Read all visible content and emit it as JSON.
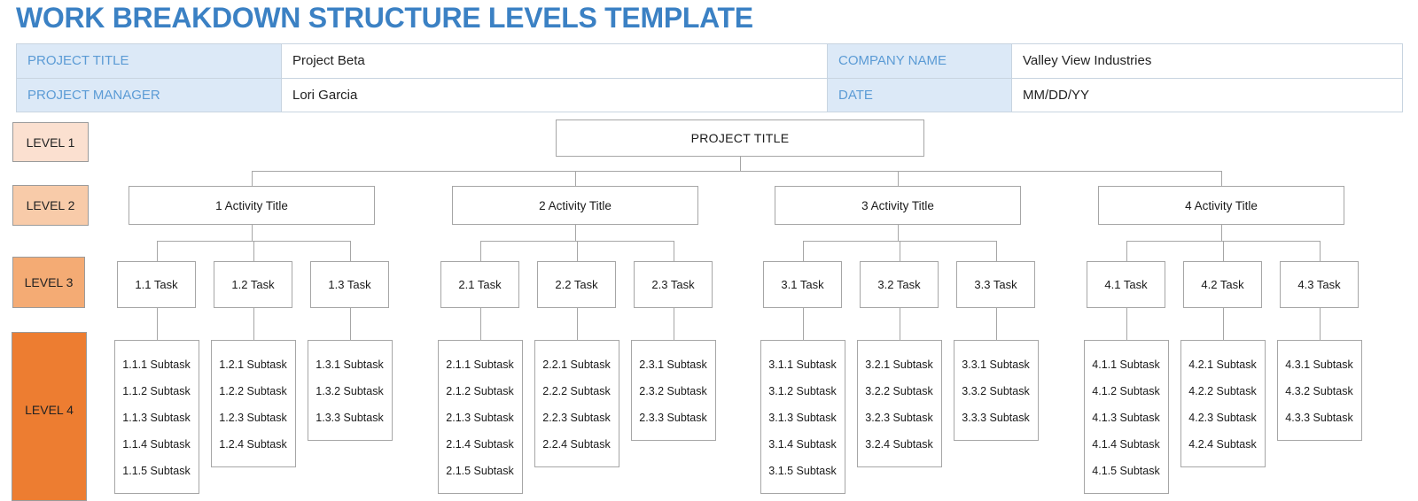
{
  "document": {
    "title": "WORK BREAKDOWN STRUCTURE LEVELS TEMPLATE",
    "title_color": "#3b81c4"
  },
  "info": {
    "project_title_label": "PROJECT TITLE",
    "project_title_value": "Project Beta",
    "company_name_label": "COMPANY NAME",
    "company_name_value": "Valley View Industries",
    "project_manager_label": "PROJECT MANAGER",
    "project_manager_value": "Lori Garcia",
    "date_label": "DATE",
    "date_value": "MM/DD/YY",
    "label_bg": "#dce9f7",
    "label_color": "#5b9bd5"
  },
  "levels": [
    {
      "label": "LEVEL 1",
      "color": "#fbe0d0"
    },
    {
      "label": "LEVEL 2",
      "color": "#f8cba9"
    },
    {
      "label": "LEVEL 3",
      "color": "#f4ab74"
    },
    {
      "label": "LEVEL 4",
      "color": "#ed7d31"
    }
  ],
  "tree": {
    "root": "PROJECT TITLE",
    "branches": [
      {
        "activity": "1 Activity Title",
        "tasks": [
          {
            "name": "1.1 Task",
            "subtasks": [
              "1.1.1 Subtask",
              "1.1.2 Subtask",
              "1.1.3 Subtask",
              "1.1.4 Subtask",
              "1.1.5 Subtask"
            ]
          },
          {
            "name": "1.2 Task",
            "subtasks": [
              "1.2.1 Subtask",
              "1.2.2 Subtask",
              "1.2.3 Subtask",
              "1.2.4 Subtask"
            ]
          },
          {
            "name": "1.3 Task",
            "subtasks": [
              "1.3.1 Subtask",
              "1.3.2 Subtask",
              "1.3.3 Subtask"
            ]
          }
        ]
      },
      {
        "activity": "2 Activity Title",
        "tasks": [
          {
            "name": "2.1 Task",
            "subtasks": [
              "2.1.1 Subtask",
              "2.1.2 Subtask",
              "2.1.3 Subtask",
              "2.1.4 Subtask",
              "2.1.5 Subtask"
            ]
          },
          {
            "name": "2.2 Task",
            "subtasks": [
              "2.2.1 Subtask",
              "2.2.2 Subtask",
              "2.2.3 Subtask",
              "2.2.4 Subtask"
            ]
          },
          {
            "name": "2.3 Task",
            "subtasks": [
              "2.3.1 Subtask",
              "2.3.2 Subtask",
              "2.3.3 Subtask"
            ]
          }
        ]
      },
      {
        "activity": "3 Activity Title",
        "tasks": [
          {
            "name": "3.1 Task",
            "subtasks": [
              "3.1.1 Subtask",
              "3.1.2 Subtask",
              "3.1.3 Subtask",
              "3.1.4 Subtask",
              "3.1.5 Subtask"
            ]
          },
          {
            "name": "3.2 Task",
            "subtasks": [
              "3.2.1 Subtask",
              "3.2.2 Subtask",
              "3.2.3 Subtask",
              "3.2.4 Subtask"
            ]
          },
          {
            "name": "3.3 Task",
            "subtasks": [
              "3.3.1 Subtask",
              "3.3.2 Subtask",
              "3.3.3 Subtask"
            ]
          }
        ]
      },
      {
        "activity": "4 Activity Title",
        "tasks": [
          {
            "name": "4.1 Task",
            "subtasks": [
              "4.1.1 Subtask",
              "4.1.2 Subtask",
              "4.1.3 Subtask",
              "4.1.4 Subtask",
              "4.1.5 Subtask"
            ]
          },
          {
            "name": "4.2 Task",
            "subtasks": [
              "4.2.1 Subtask",
              "4.2.2 Subtask",
              "4.2.3 Subtask",
              "4.2.4 Subtask"
            ]
          },
          {
            "name": "4.3 Task",
            "subtasks": [
              "4.3.1 Subtask",
              "4.3.2 Subtask",
              "4.3.3 Subtask"
            ]
          }
        ]
      }
    ]
  }
}
